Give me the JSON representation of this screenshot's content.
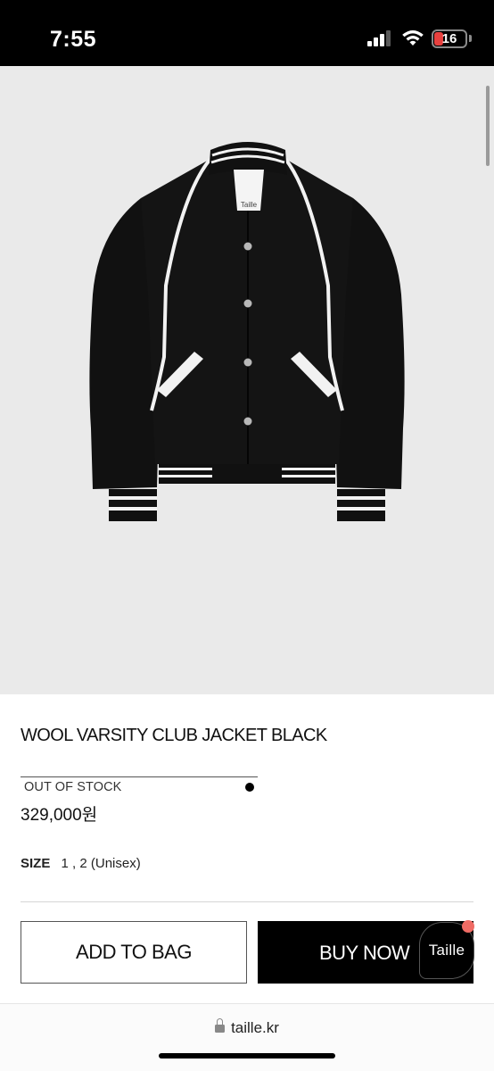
{
  "status_bar": {
    "time": "7:55",
    "battery_level": "16",
    "icons": [
      "signal-icon",
      "wifi-icon",
      "battery-icon"
    ]
  },
  "product": {
    "image_alt": "jacket-image",
    "brand_label": "Taille",
    "title": "WOOL VARSITY CLUB JACKET BLACK",
    "option_text": "OUT OF STOCK",
    "price": "329,000원",
    "size_label": "SIZE",
    "size_value": "1 , 2 (Unisex)"
  },
  "actions": {
    "add_to_bag": "ADD TO BAG",
    "buy_now": "BUY NOW",
    "chat_label": "Taille"
  },
  "browser": {
    "url": "taille.kr"
  },
  "colors": {
    "accent": "#000000",
    "notification_dot": "#f06b64",
    "battery_low": "#e8413f"
  }
}
